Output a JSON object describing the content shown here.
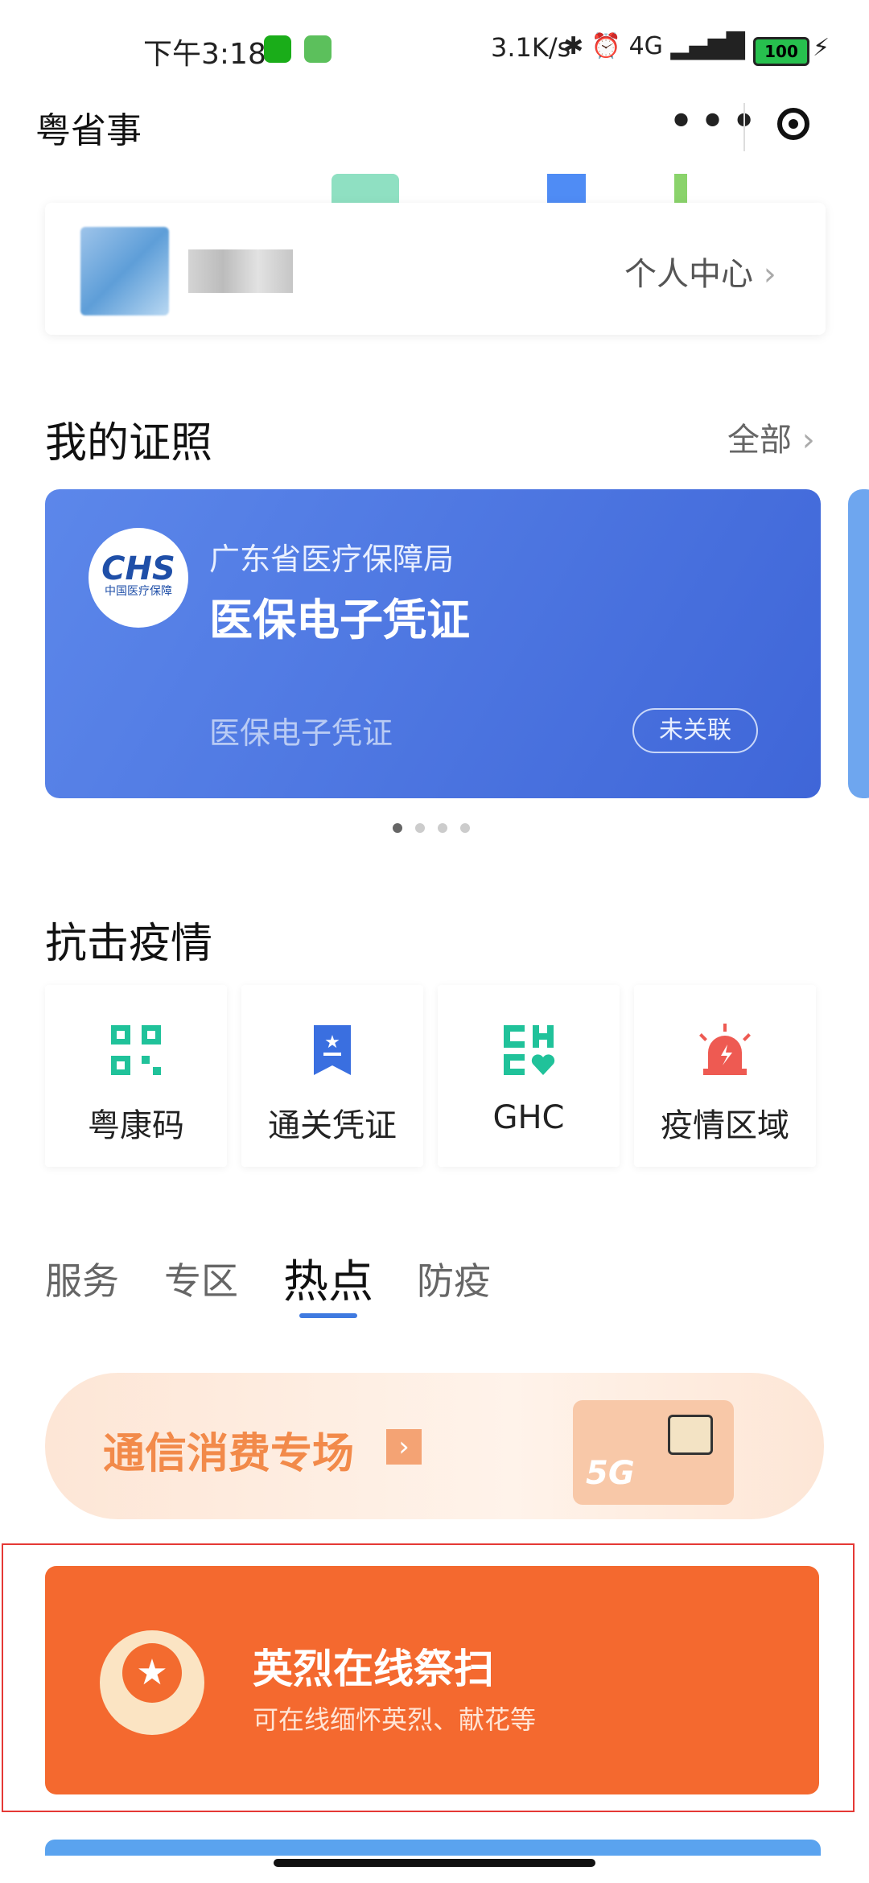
{
  "status_bar": {
    "time": "下午3:18",
    "network_speed": "3.1K/s",
    "signal_icons": "✱ ⏰ 4G ▂▄▆█ ◠",
    "battery": "100"
  },
  "nav": {
    "title": "粤省事",
    "more": "•••"
  },
  "profile": {
    "link_label": "个人中心",
    "chevron": "›"
  },
  "certificates": {
    "section_title": "我的证照",
    "all_label": "全部",
    "card": {
      "logo_text": "CHS",
      "logo_sub": "中国医疗保障",
      "org": "广东省医疗保障局",
      "name": "医保电子凭证",
      "subtitle": "医保电子凭证",
      "badge": "未关联"
    }
  },
  "epidemic": {
    "section_title": "抗击疫情",
    "items": [
      {
        "label": "粤康码",
        "icon": "qr-code-icon"
      },
      {
        "label": "通关凭证",
        "icon": "pass-ticket-icon"
      },
      {
        "label": "GHC",
        "icon": "ghc-heart-icon"
      },
      {
        "label": "疫情区域",
        "icon": "alarm-light-icon"
      }
    ]
  },
  "tabs": [
    {
      "label": "服务",
      "active": false
    },
    {
      "label": "专区",
      "active": false
    },
    {
      "label": "热点",
      "active": true
    },
    {
      "label": "防疫",
      "active": false
    }
  ],
  "promo": {
    "text": "通信消费专场",
    "arrow": "›",
    "sim_label": "5G"
  },
  "martyr": {
    "title": "英烈在线祭扫",
    "subtitle": "可在线缅怀英烈、献花等",
    "medal_glyph": "★"
  },
  "colors": {
    "cert_blue": "#4a72df",
    "martyr_orange": "#f4692f",
    "tab_accent": "#3f7ae0",
    "icon_green": "#20c29a",
    "icon_blue": "#3a6fe0",
    "icon_red": "#ee5a52"
  }
}
